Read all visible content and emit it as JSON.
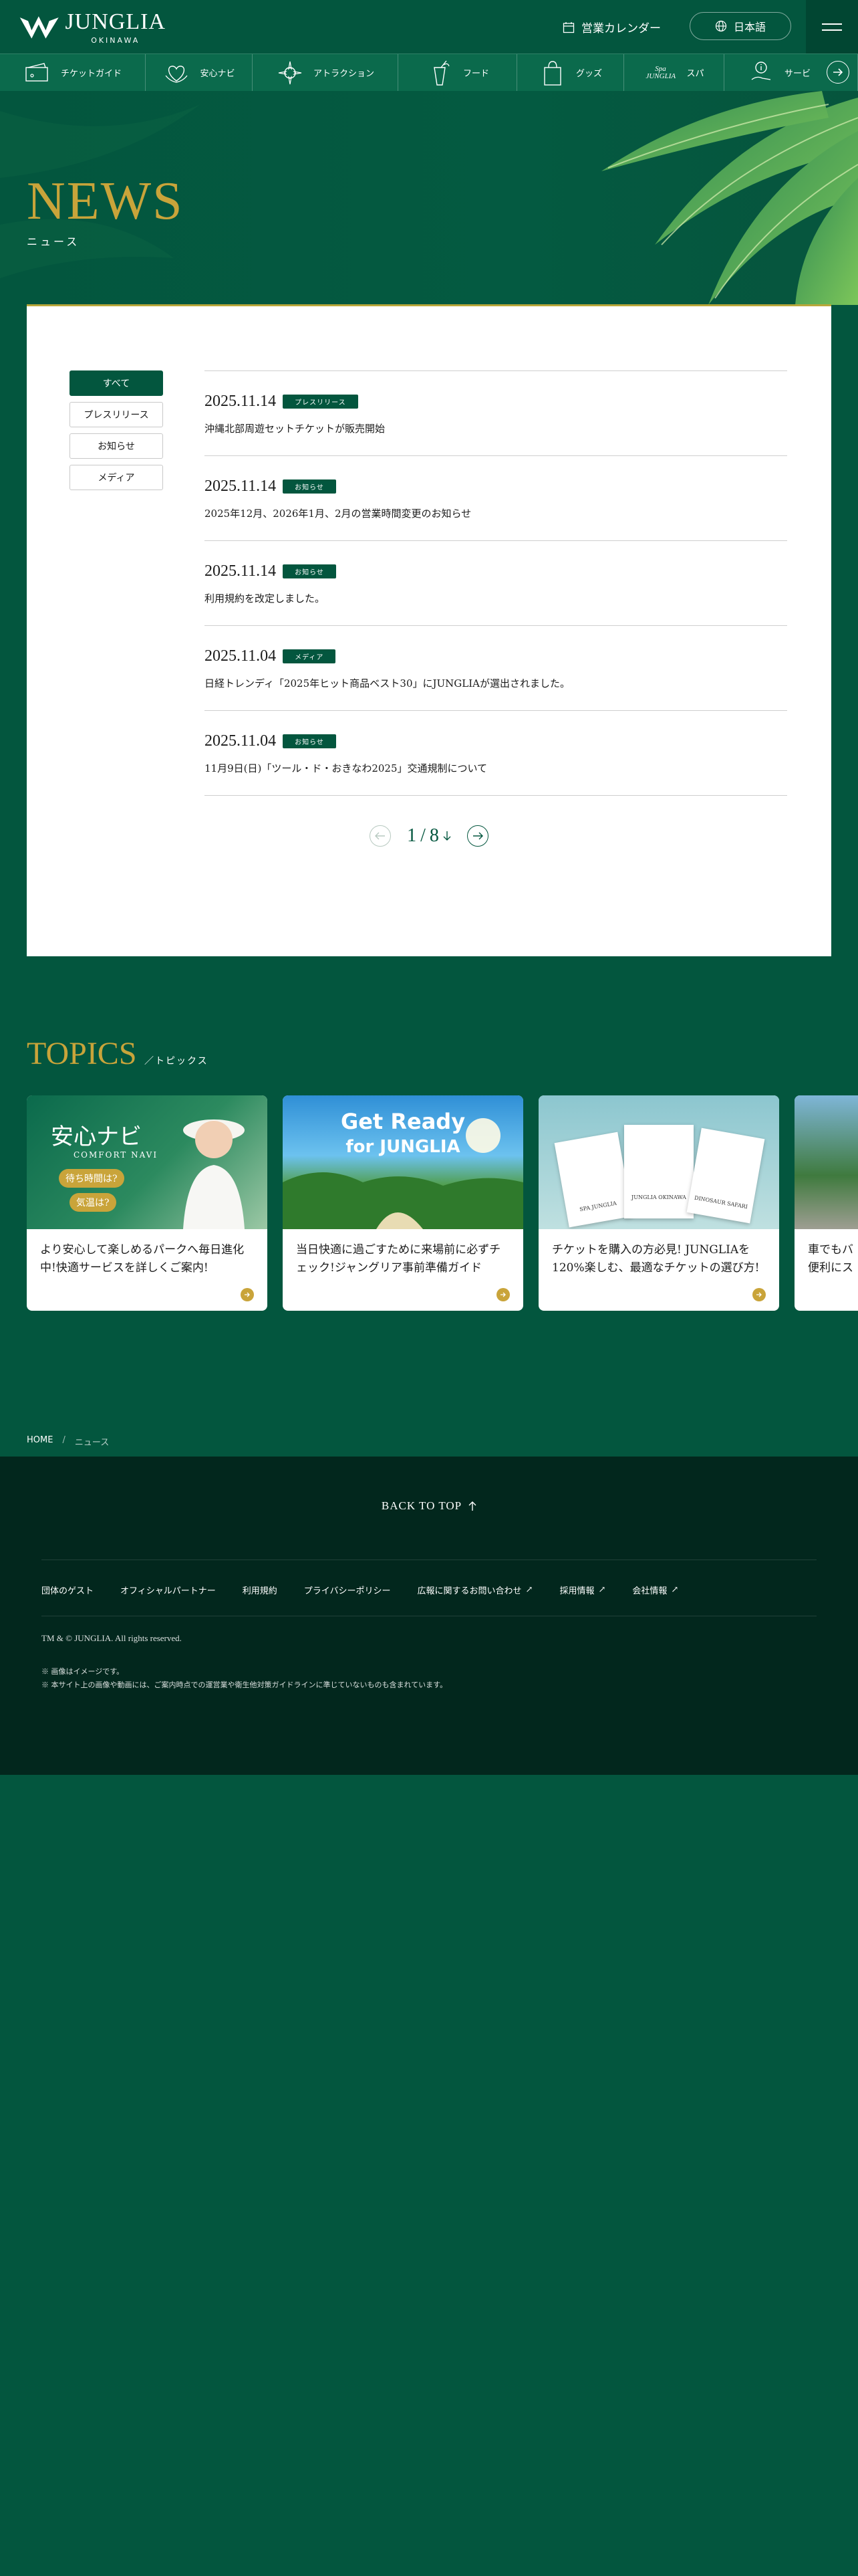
{
  "header": {
    "logo_text": "JUNGLIA",
    "logo_sub": "OKINAWA",
    "calendar_label": "営業カレンダー",
    "language_label": "日本語"
  },
  "nav": {
    "items": [
      {
        "label": "チケットガイド",
        "icon": "ticket-icon"
      },
      {
        "label": "安心ナビ",
        "icon": "heart-hands-icon"
      },
      {
        "label": "アトラクション",
        "icon": "compass-icon"
      },
      {
        "label": "フード",
        "icon": "drink-icon"
      },
      {
        "label": "グッズ",
        "icon": "shopping-bag-icon"
      },
      {
        "label": "スパ",
        "icon": "spa-logo-icon"
      },
      {
        "label": "サービ",
        "icon": "info-hand-icon"
      }
    ],
    "spa_logo_text": "Spa JUNGLIA"
  },
  "hero": {
    "title": "NEWS",
    "subtitle": "ニュース"
  },
  "filters": [
    {
      "label": "すべて",
      "active": true
    },
    {
      "label": "プレスリリース",
      "active": false
    },
    {
      "label": "お知らせ",
      "active": false
    },
    {
      "label": "メディア",
      "active": false
    }
  ],
  "news": [
    {
      "date": "2025.11.14",
      "category": "プレスリリース",
      "title": "沖縄北部周遊セットチケットが販売開始"
    },
    {
      "date": "2025.11.14",
      "category": "お知らせ",
      "title": "2025年12月、2026年1月、2月の営業時間変更のお知らせ"
    },
    {
      "date": "2025.11.14",
      "category": "お知らせ",
      "title": "利用規約を改定しました。"
    },
    {
      "date": "2025.11.04",
      "category": "メディア",
      "title": "日経トレンディ「2025年ヒット商品ベスト30」にJUNGLIAが選出されました。"
    },
    {
      "date": "2025.11.04",
      "category": "お知らせ",
      "title": "11月9日(日)「ツール・ド・おきなわ2025」交通規制について"
    }
  ],
  "pager": {
    "current": "1",
    "separator": "/",
    "total": "8"
  },
  "topics": {
    "title": "TOPICS",
    "subtitle": "／トピックス",
    "cards": [
      {
        "text": "より安心して楽しめるパークへ毎日進化中!快適サービスを詳しくご案内!",
        "img_title": "安心ナビ",
        "img_sub": "COMFORT NAVI",
        "img_bubble1": "待ち時間は?",
        "img_bubble2": "気温は?"
      },
      {
        "text": "当日快適に過ごすために来場前に必ずチェック!ジャングリア事前準備ガイド",
        "img_title": "Get Ready",
        "img_sub": "for JUNGLIA"
      },
      {
        "text": "チケットを購入の方必見! JUNGLIAを120%楽しむ、最適なチケットの選び方!",
        "img_title": "JUNGLIA OKINAWA",
        "img_sub": "DINOSAUR SAFARI",
        "img_spa": "SPA JUNGLIA"
      },
      {
        "text": "車でもバ便利にス"
      }
    ]
  },
  "breadcrumb": {
    "home": "HOME",
    "separator": "/",
    "current": "ニュース"
  },
  "footer": {
    "back_to_top": "BACK TO TOP",
    "links": [
      {
        "label": "団体のゲスト",
        "external": false
      },
      {
        "label": "オフィシャルパートナー",
        "external": false
      },
      {
        "label": "利用規約",
        "external": false
      },
      {
        "label": "プライバシーポリシー",
        "external": false
      },
      {
        "label": "広報に関するお問い合わせ",
        "external": true
      },
      {
        "label": "採用情報",
        "external": true
      },
      {
        "label": "会社情報",
        "external": true
      }
    ],
    "external_mark": "↗",
    "copyright": "TM & © JUNGLIA. All rights reserved.",
    "note1": "※ 画像はイメージです。",
    "note2": "※ 本サイト上の画像や動画には、ご案内時点での運営業や衛生他対策ガイドラインに準じていないものも含まれています。"
  },
  "colors": {
    "brand_green": "#03563e",
    "gold": "#c9a43a",
    "footer_dark": "#02271d"
  }
}
